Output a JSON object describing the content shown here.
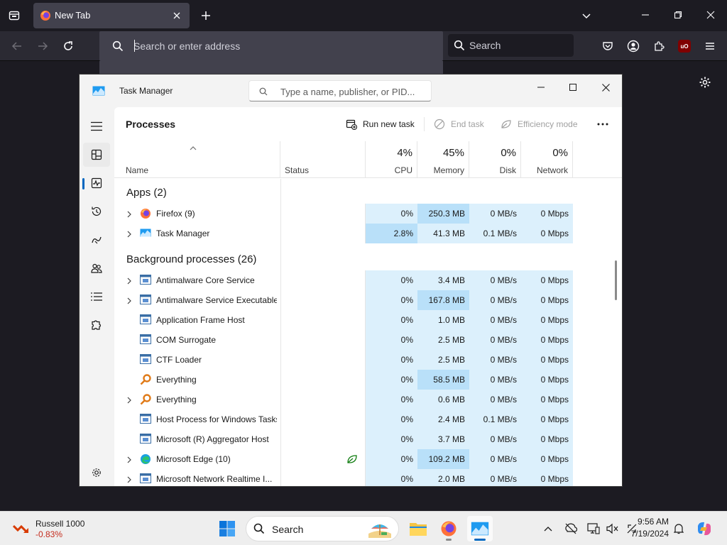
{
  "browser": {
    "tab_title": "New Tab",
    "url_placeholder": "Search or enter address",
    "search_placeholder": "Search",
    "ublock_label": "uO",
    "colors": {
      "frame": "#1c1b22",
      "toolbar": "#2b2a33",
      "field": "#42414d"
    }
  },
  "taskmgr": {
    "title": "Task Manager",
    "search_placeholder": "Type a name, publisher, or PID...",
    "page_title": "Processes",
    "toolbar": {
      "run_new_task": "Run new task",
      "end_task": "End task",
      "efficiency_mode": "Efficiency mode"
    },
    "nav": [
      "menu-icon",
      "processes-icon",
      "performance-icon",
      "app-history-icon",
      "startup-apps-icon",
      "users-icon",
      "details-icon",
      "services-icon",
      "settings-icon"
    ],
    "columns": {
      "name": "Name",
      "status": "Status",
      "cpu_pct": "4%",
      "cpu": "CPU",
      "memory_pct": "45%",
      "memory": "Memory",
      "disk_pct": "0%",
      "disk": "Disk",
      "network_pct": "0%",
      "network": "Network"
    },
    "groups": {
      "apps": "Apps (2)",
      "background": "Background processes (26)"
    },
    "apps": [
      {
        "name": "Firefox (9)",
        "cpu": "0%",
        "memory": "250.3 MB",
        "disk": "0 MB/s",
        "network": "0 Mbps"
      },
      {
        "name": "Task Manager",
        "cpu": "2.8%",
        "memory": "41.3 MB",
        "disk": "0.1 MB/s",
        "network": "0 Mbps"
      }
    ],
    "background": [
      {
        "name": "Antimalware Core Service",
        "cpu": "0%",
        "memory": "3.4 MB",
        "disk": "0 MB/s",
        "network": "0 Mbps"
      },
      {
        "name": "Antimalware Service Executable",
        "cpu": "0%",
        "memory": "167.8 MB",
        "disk": "0 MB/s",
        "network": "0 Mbps"
      },
      {
        "name": "Application Frame Host",
        "cpu": "0%",
        "memory": "1.0 MB",
        "disk": "0 MB/s",
        "network": "0 Mbps"
      },
      {
        "name": "COM Surrogate",
        "cpu": "0%",
        "memory": "2.5 MB",
        "disk": "0 MB/s",
        "network": "0 Mbps"
      },
      {
        "name": "CTF Loader",
        "cpu": "0%",
        "memory": "2.5 MB",
        "disk": "0 MB/s",
        "network": "0 Mbps"
      },
      {
        "name": "Everything",
        "cpu": "0%",
        "memory": "58.5 MB",
        "disk": "0 MB/s",
        "network": "0 Mbps"
      },
      {
        "name": "Everything",
        "cpu": "0%",
        "memory": "0.6 MB",
        "disk": "0 MB/s",
        "network": "0 Mbps"
      },
      {
        "name": "Host Process for Windows Tasks",
        "cpu": "0%",
        "memory": "2.4 MB",
        "disk": "0.1 MB/s",
        "network": "0 Mbps"
      },
      {
        "name": "Microsoft (R) Aggregator Host",
        "cpu": "0%",
        "memory": "3.7 MB",
        "disk": "0 MB/s",
        "network": "0 Mbps"
      },
      {
        "name": "Microsoft Edge (10)",
        "cpu": "0%",
        "memory": "109.2 MB",
        "disk": "0 MB/s",
        "network": "0 Mbps"
      },
      {
        "name": "Microsoft Network Realtime I...",
        "cpu": "0%",
        "memory": "2.0 MB",
        "disk": "0 MB/s",
        "network": "0 Mbps"
      }
    ]
  },
  "taskbar": {
    "widget_name": "Russell 1000",
    "widget_value": "-0.83%",
    "search_label": "Search",
    "time": "9:56 AM",
    "date": "7/19/2024"
  }
}
